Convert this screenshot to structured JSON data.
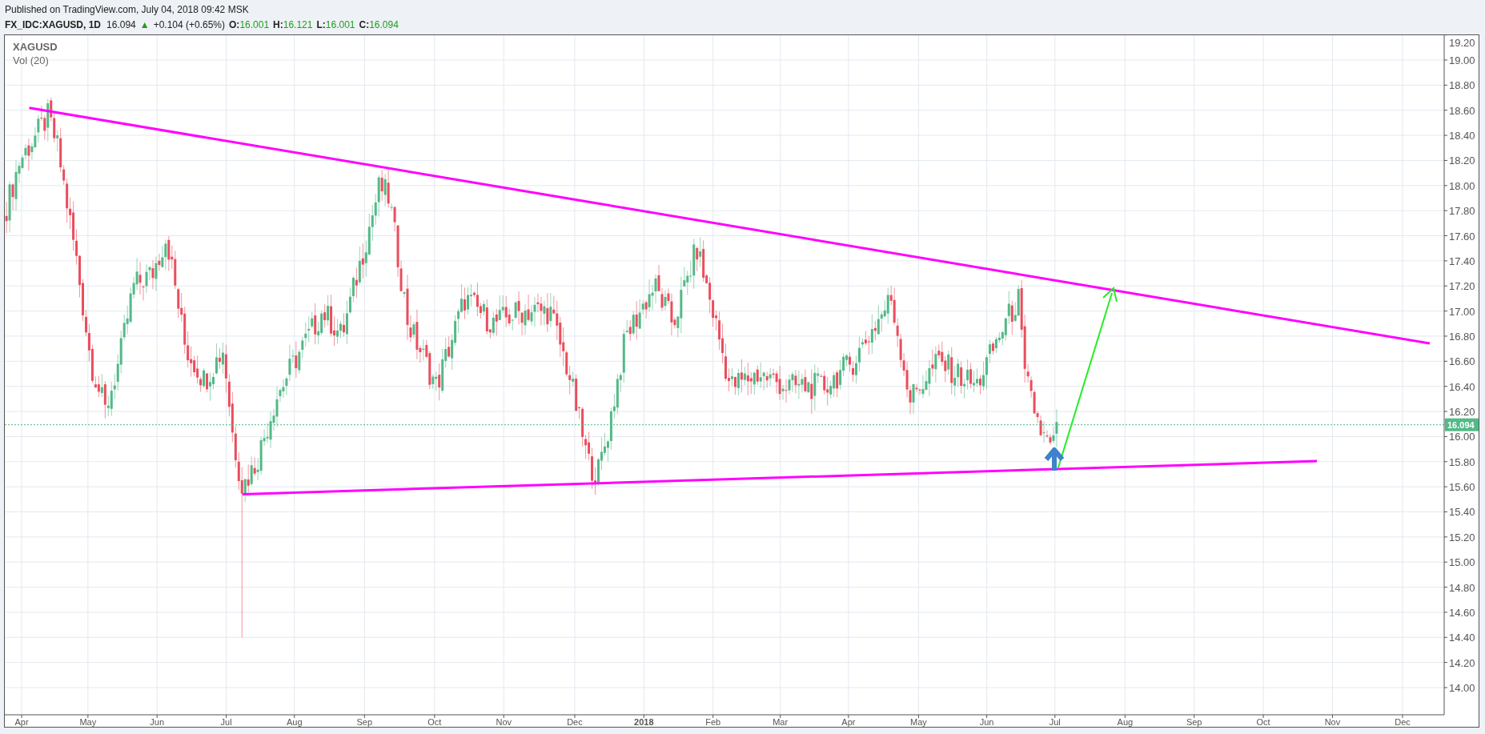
{
  "header": {
    "published": "Published on TradingView.com, July 04, 2018 09:42 MSK"
  },
  "symbol_bar": {
    "symbol": "FX_IDC:XAGUSD, 1D",
    "last": "16.094",
    "change_arrow": "▲",
    "change": "+0.104 (+0.65%)",
    "ohlc": [
      {
        "label": "O:",
        "value": "16.001"
      },
      {
        "label": "H:",
        "value": "16.121"
      },
      {
        "label": "L:",
        "value": "16.001"
      },
      {
        "label": "C:",
        "value": "16.094"
      }
    ]
  },
  "legend": {
    "symbol": "XAGUSD",
    "indicator": "Vol (20)"
  },
  "price_axis": {
    "ticks": [
      "19.20",
      "19.00",
      "18.80",
      "18.60",
      "18.40",
      "18.20",
      "18.00",
      "17.80",
      "17.60",
      "17.40",
      "17.20",
      "17.00",
      "16.80",
      "16.60",
      "16.40",
      "16.20",
      "16.00",
      "15.80",
      "15.60",
      "15.40",
      "15.20",
      "15.00",
      "14.80",
      "14.60",
      "14.40",
      "14.20",
      "14.00"
    ],
    "current_price": "16.094"
  },
  "time_axis": {
    "ticks": [
      {
        "label": "Apr",
        "year": false
      },
      {
        "label": "May",
        "year": false
      },
      {
        "label": "Jun",
        "year": false
      },
      {
        "label": "Jul",
        "year": false
      },
      {
        "label": "Aug",
        "year": false
      },
      {
        "label": "Sep",
        "year": false
      },
      {
        "label": "Oct",
        "year": false
      },
      {
        "label": "Nov",
        "year": false
      },
      {
        "label": "Dec",
        "year": false
      },
      {
        "label": "2018",
        "year": true
      },
      {
        "label": "Feb",
        "year": false
      },
      {
        "label": "Mar",
        "year": false
      },
      {
        "label": "Apr",
        "year": false
      },
      {
        "label": "May",
        "year": false
      },
      {
        "label": "Jun",
        "year": false
      },
      {
        "label": "Jul",
        "year": false
      },
      {
        "label": "Aug",
        "year": false
      },
      {
        "label": "Sep",
        "year": false
      },
      {
        "label": "Oct",
        "year": false
      },
      {
        "label": "Nov",
        "year": false
      },
      {
        "label": "Dec",
        "year": false
      }
    ]
  }
}
